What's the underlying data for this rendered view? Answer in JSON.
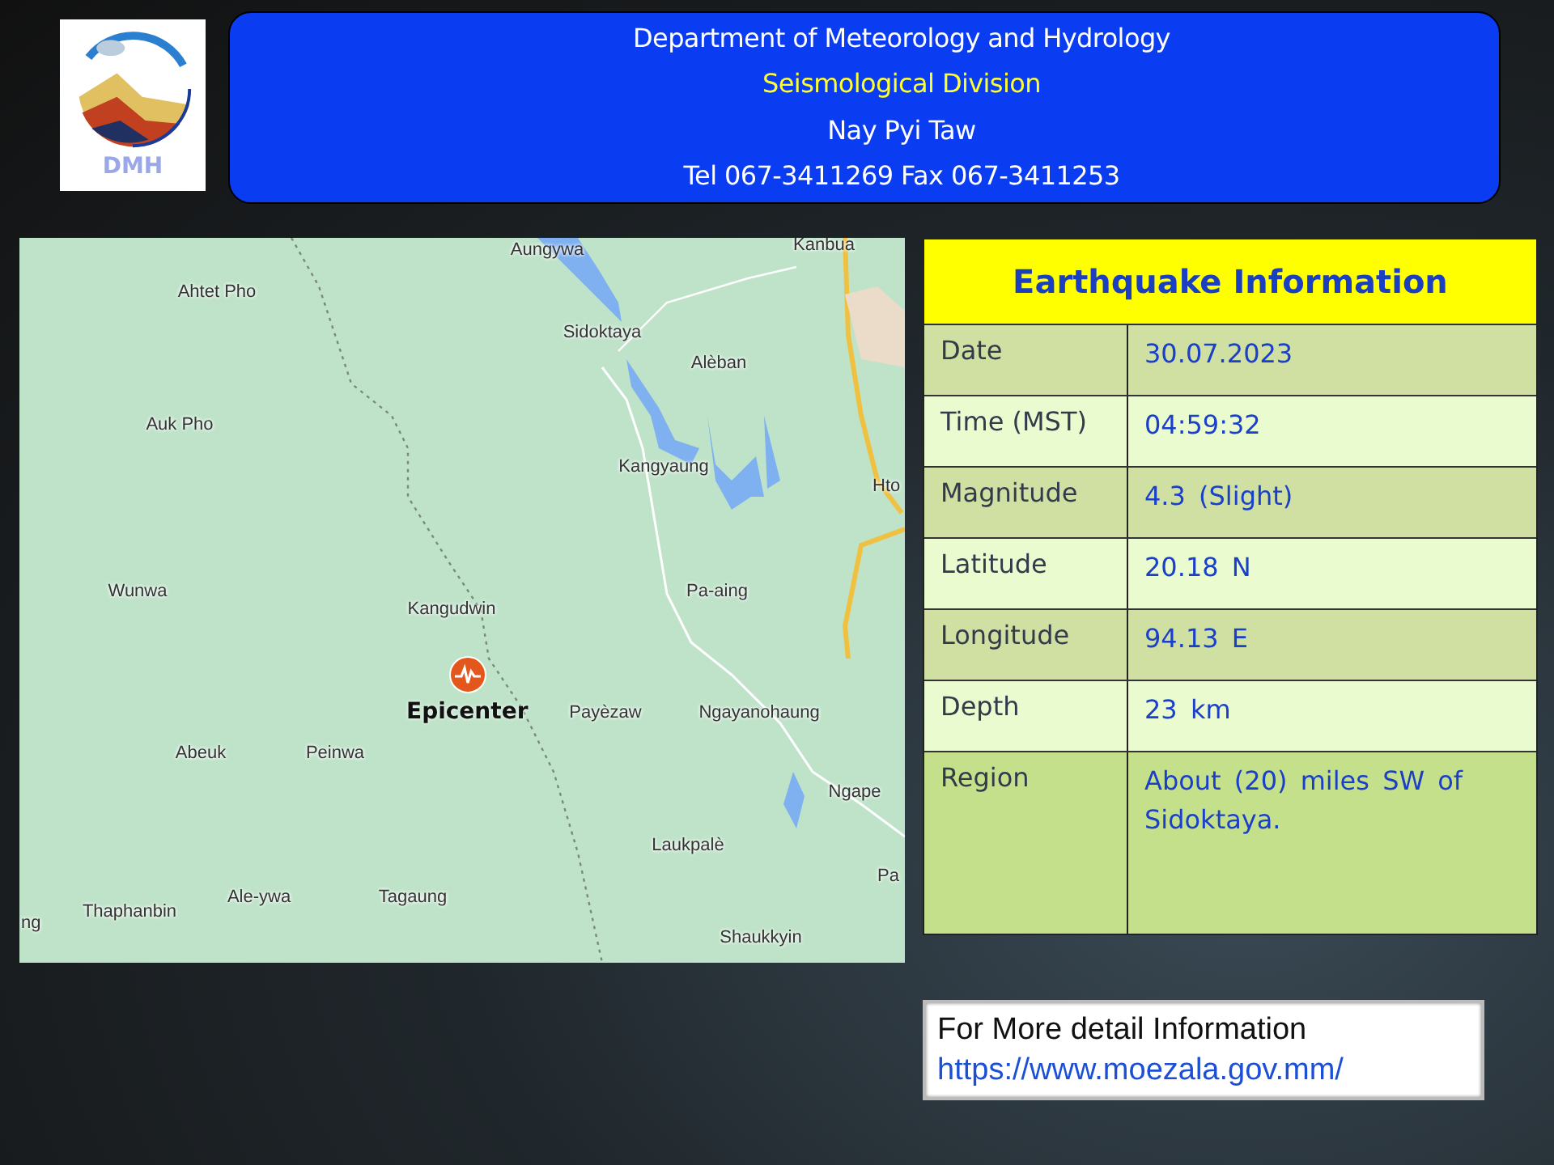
{
  "header": {
    "logo_text": "DMH",
    "lines": [
      {
        "text": "Department of Meteorology and Hydrology",
        "kind": "plain"
      },
      {
        "text": "Seismological Division",
        "kind": "highlight"
      },
      {
        "text": "Nay Pyi Taw",
        "kind": "plain"
      },
      {
        "text": "Tel 067-3411269 Fax 067-3411253",
        "kind": "plain"
      }
    ]
  },
  "map": {
    "epicenter_label": "Epicenter",
    "places": [
      "Aungywa",
      "Kanbua",
      "Ahtet Pho",
      "Sidoktaya",
      "Alèban",
      "Auk Pho",
      "Kangyaung",
      "Hto",
      "Wunwa",
      "Pa-aing",
      "Kangudwin",
      "Payèzaw",
      "Ngayanohaung",
      "Abeuk",
      "Peinwa",
      "Ngape",
      "Laukpalè",
      "Pa",
      "Ale-ywa",
      "Tagaung",
      "Thaphanbin",
      "ng",
      "Shaukkyin"
    ]
  },
  "info_table": {
    "title": "Earthquake Information",
    "rows": [
      {
        "label": "Date",
        "value": "30.07.2023"
      },
      {
        "label": "Time (MST)",
        "value": "04:59:32"
      },
      {
        "label": "Magnitude",
        "value": "4.3 (Slight)"
      },
      {
        "label": "Latitude",
        "value": "20.18 N"
      },
      {
        "label": "Longitude",
        "value": "94.13 E"
      },
      {
        "label": "Depth",
        "value": "23 km"
      },
      {
        "label": "Region",
        "value": "About (20) miles SW of Sidoktaya."
      }
    ]
  },
  "more_info": {
    "text": "For More detail Information",
    "link": "https://www.moezala.gov.mm/"
  }
}
